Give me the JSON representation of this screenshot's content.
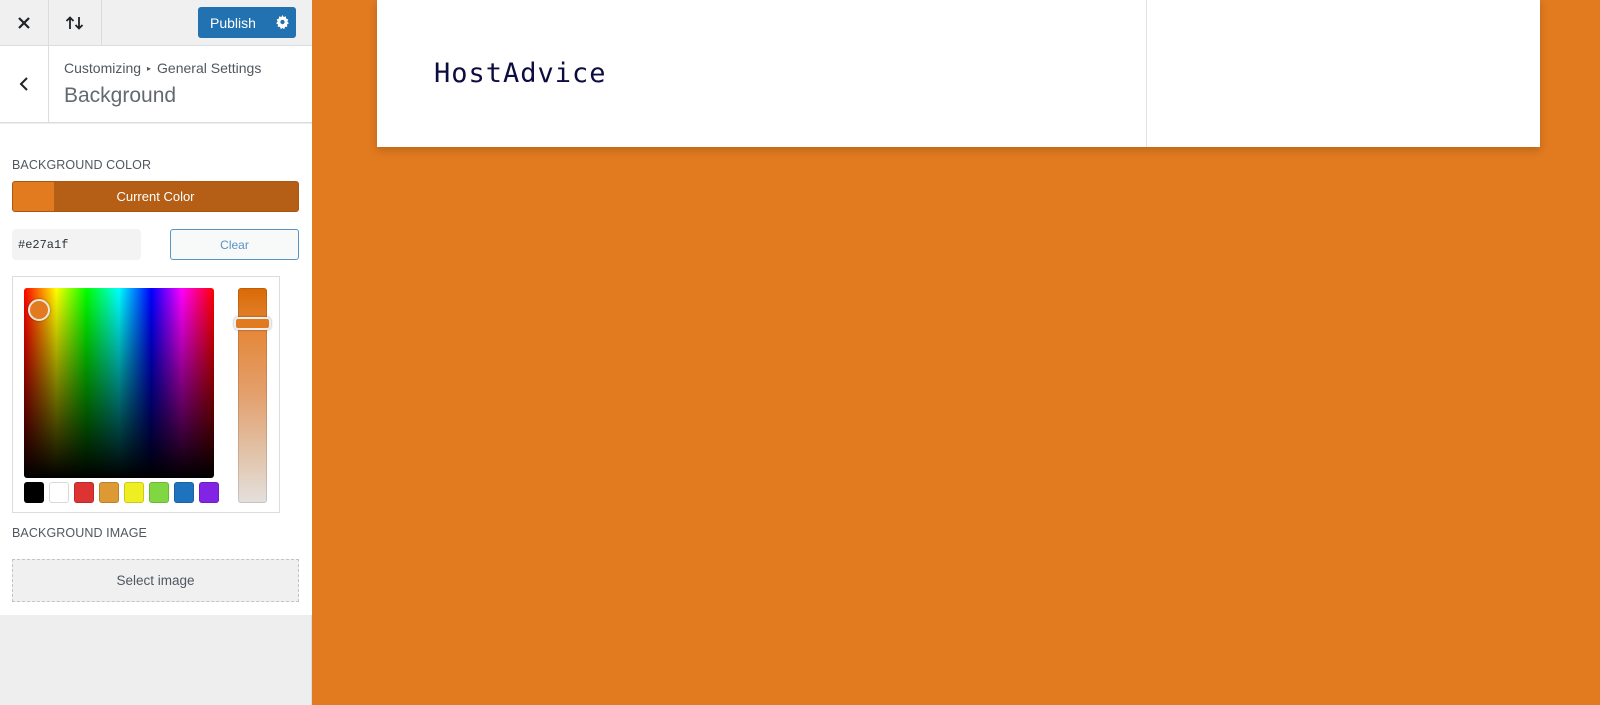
{
  "topbar": {
    "close_icon": "close-icon",
    "preview_toggle_icon": "arrows-up-down-icon",
    "publish_label": "Publish",
    "publish_settings_icon": "gear-icon"
  },
  "section": {
    "back_icon": "chevron-left-icon",
    "breadcrumb_root": "Customizing",
    "breadcrumb_separator": "▸",
    "breadcrumb_parent": "General Settings",
    "title": "Background"
  },
  "background_color": {
    "label": "BACKGROUND COLOR",
    "current_color_label": "Current Color",
    "value": "#e27a1f",
    "hex_value": "#e27a1f",
    "clear_label": "Clear",
    "palette": [
      "#000000",
      "#ffffff",
      "#dd3333",
      "#dd9933",
      "#eeee22",
      "#81d742",
      "#1e73be",
      "#8224e3"
    ]
  },
  "background_image": {
    "label": "BACKGROUND IMAGE",
    "select_label": "Select image"
  },
  "preview": {
    "site_title": "HostAdvice",
    "background_color": "#e27a1f"
  }
}
